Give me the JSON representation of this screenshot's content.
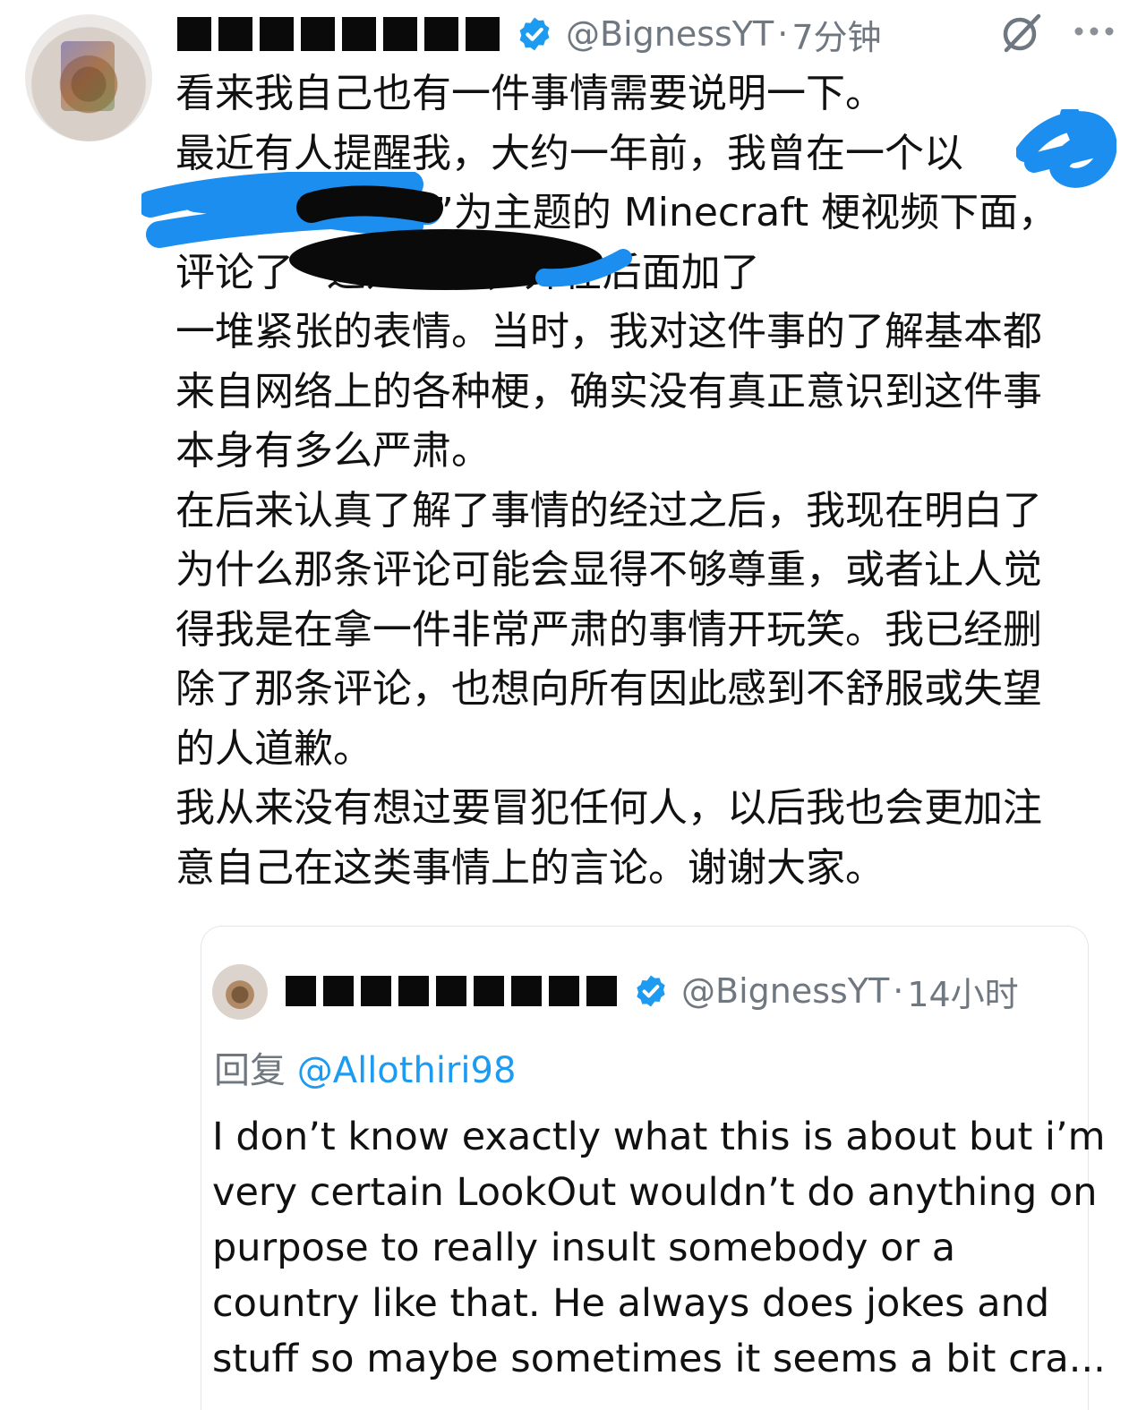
{
  "post": {
    "author_handle": "@BignessYT",
    "separator": "·",
    "time": "7分钟",
    "lines": [
      "看来我自己也有一件事情需要说明一下。",
      "最近有人提醒我，大约一年前，我曾在一个以",
      "”为主题的 Minecraft 梗视频下面，",
      "评论了                              ”这几个字，并在后面加了",
      "一堆紧张的表情。当时，我对这件事的了解基本都",
      "来自网络上的各种梗，确实没有真正意识到这件事",
      "本身有多么严肃。",
      "在后来认真了解了事情的经过之后，我现在明白了",
      "为什么那条评论可能会显得不够尊重，或者让人觉",
      "得我是在拿一件非常严肃的事情开玩笑。我已经删",
      "除了那条评论，也想向所有因此感到不舒服或失望",
      "的人道歉。",
      "我从来没有想过要冒犯任何人，以后我也会更加注",
      "意自己在这类事情上的言论。谢谢大家。"
    ]
  },
  "quoted": {
    "author_handle": "@BignessYT",
    "separator": "·",
    "time": "14小时",
    "reply_label": "回复",
    "reply_handle": "@Allothiri98",
    "lines": [
      "I don’t know exactly what this is about but i’m",
      "very certain LookOut wouldn’t do anything on",
      "purpose to really insult somebody or a",
      "country like that. He always does jokes and",
      "stuff so maybe sometimes it seems a bit cra..."
    ]
  },
  "icons": {
    "verified": "verified-badge-icon",
    "grok": "grok-icon",
    "more": "more-options-icon"
  },
  "colors": {
    "verified_blue": "#1d9bf0",
    "meta_gray": "#6f7780",
    "redaction_blue": "#1c8ef0",
    "redaction_black": "#0a0a0a"
  }
}
